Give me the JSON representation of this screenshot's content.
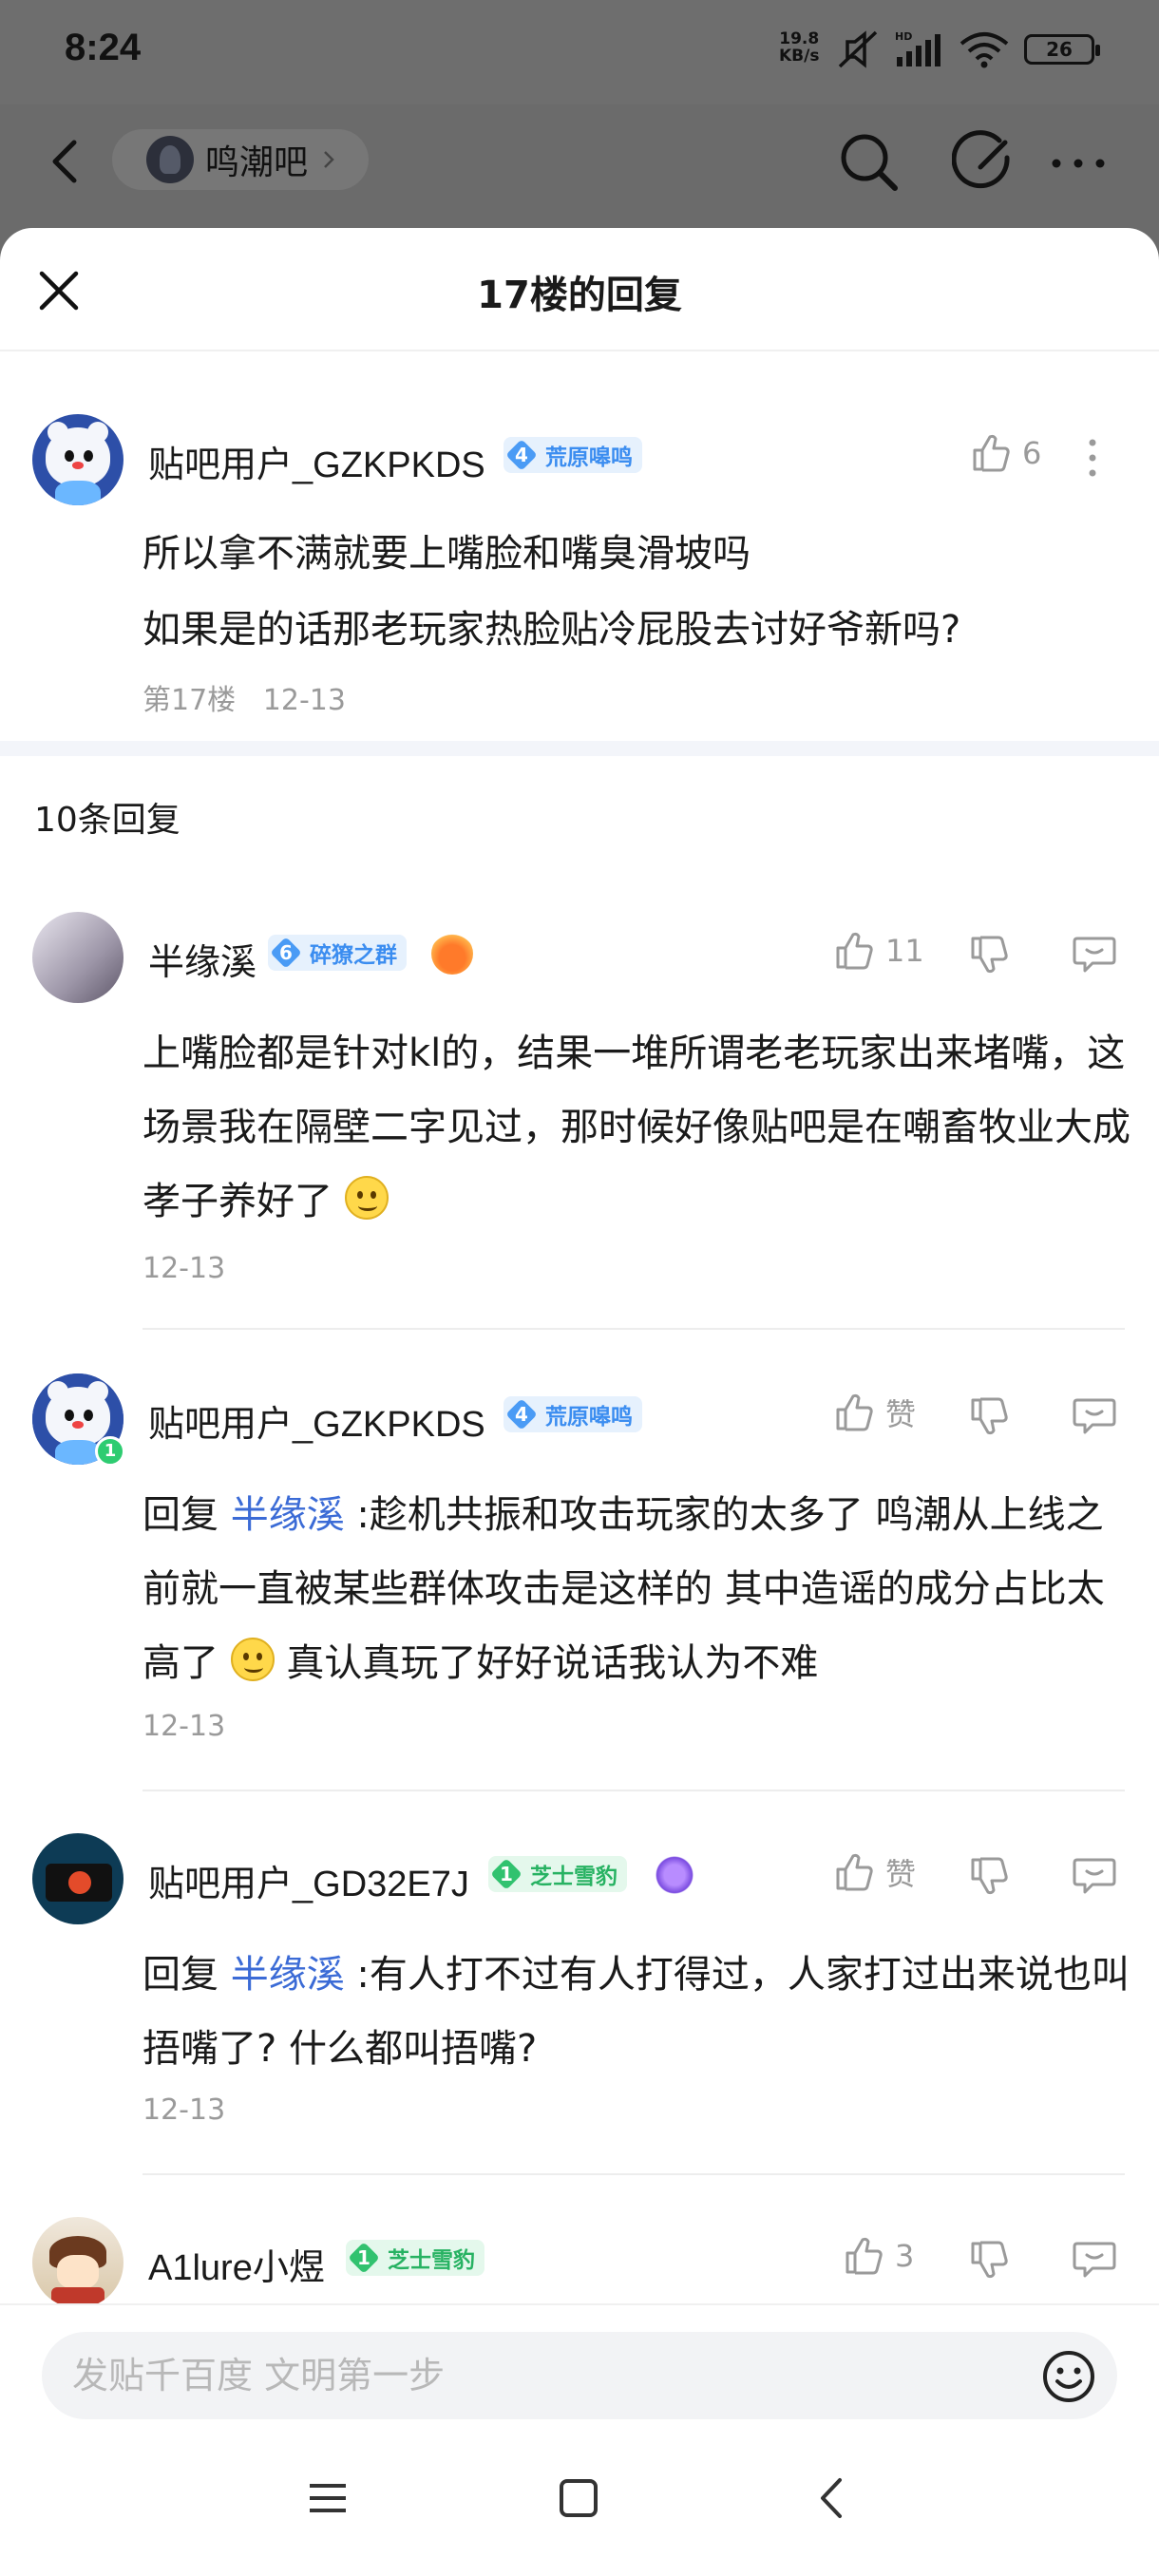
{
  "status_bar": {
    "time": "8:24",
    "net_speed_value": "19.8",
    "net_speed_unit": "KB/s",
    "hd": "HD",
    "battery": "26"
  },
  "top_nav": {
    "forum_name": "鸣潮吧"
  },
  "sheet": {
    "title": "17楼的回复"
  },
  "main_post": {
    "username": "贴吧用户_GZKPKDS",
    "level": "4",
    "level_title": "荒原嗥鸣",
    "likes": "6",
    "lines": [
      "所以拿不满就要上嘴脸和嘴臭滑坡吗",
      "如果是的话那老玩家热脸贴冷屁股去讨好爷新吗?"
    ],
    "floor": "第17楼",
    "date": "12-13"
  },
  "replies_count": "10条回复",
  "replies": [
    {
      "username": "半缘溪",
      "level": "6",
      "level_title": "碎獠之群",
      "likes": "11",
      "text": "上嘴脸都是针对kl的，结果一堆所谓老老玩家出来堵嘴，这场景我在隔壁二字见过，那时候好像贴吧是在嘲畜牧业大成孝子养好了",
      "date": "12-13"
    },
    {
      "username": "贴吧用户_GZKPKDS",
      "level": "4",
      "level_title": "荒原嗥鸣",
      "likes": "赞",
      "reply_prefix": "回复",
      "reply_to": "半缘溪",
      "text": " :趁机共振和攻击玩家的太多了 鸣潮从上线之前就一直被某些群体攻击是这样的 其中造谣的成分占比太高了",
      "text_after_emoji": " 真认真玩了好好说话我认为不难",
      "date": "12-13",
      "avatar_badge": "1"
    },
    {
      "username": "贴吧用户_GD32E7J",
      "level": "1",
      "level_title": "芝士雪豹",
      "likes": "赞",
      "reply_prefix": "回复",
      "reply_to": "半缘溪",
      "text": " :有人打不过有人打得过，人家打过出来说也叫捂嘴了? 什么都叫捂嘴?",
      "date": "12-13"
    },
    {
      "username": "A1lure小煜",
      "level": "1",
      "level_title": "芝士雪豹",
      "likes": "3"
    }
  ],
  "input": {
    "placeholder": "发贴千百度 文明第一步"
  },
  "icons": {
    "back": "back-arrow-icon",
    "search": "search-icon",
    "edit": "edit-icon",
    "more": "more-icon",
    "close": "close-icon",
    "like": "thumb-up-icon",
    "dislike": "thumb-down-icon",
    "comment": "comment-icon",
    "emoji": "emoji-icon"
  },
  "colors": {
    "link": "#3b6bd6",
    "level_blue": "#4a9bf5",
    "level_green": "#31c26f",
    "muted": "#9a9a9a"
  }
}
